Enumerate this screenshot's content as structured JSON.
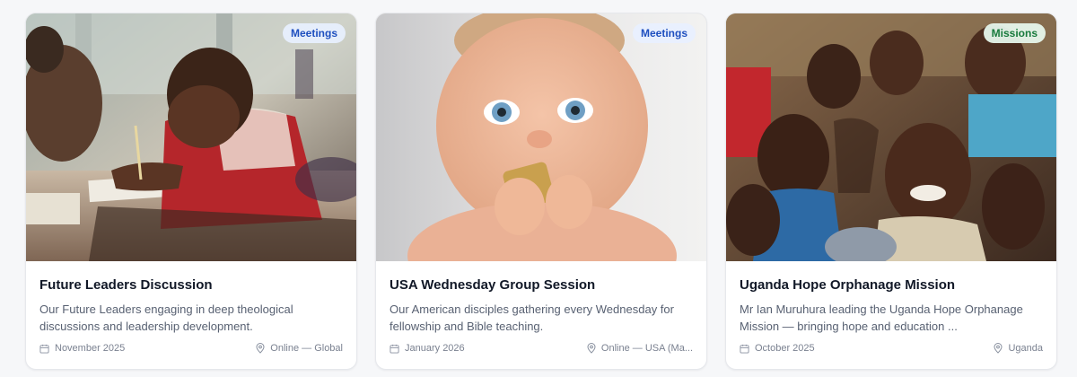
{
  "cards": [
    {
      "badge": "Meetings",
      "title": "Future Leaders Discussion",
      "description": "Our Future Leaders engaging in deep theological discussions and leadership development.",
      "date": "November 2025",
      "location": "Online — Global"
    },
    {
      "badge": "Meetings",
      "title": "USA Wednesday Group Session",
      "description": "Our American disciples gathering every Wednesday for fellowship and Bible teaching.",
      "date": "January 2026",
      "location": "Online — USA (Ma..."
    },
    {
      "badge": "Missions",
      "title": "Uganda Hope Orphanage Mission",
      "description": "Mr Ian Muruhura leading the Uganda Hope Orphanage Mission — bringing hope and education ...",
      "date": "October 2025",
      "location": "Uganda"
    }
  ],
  "colors": {
    "meetings_badge_bg": "#E8F0FF",
    "meetings_badge_text": "#1E4FBF",
    "missions_badge_bg": "#E7F8ED",
    "missions_badge_text": "#177A3C"
  },
  "icons": {
    "date": "calendar-icon",
    "location": "map-pin-icon"
  }
}
